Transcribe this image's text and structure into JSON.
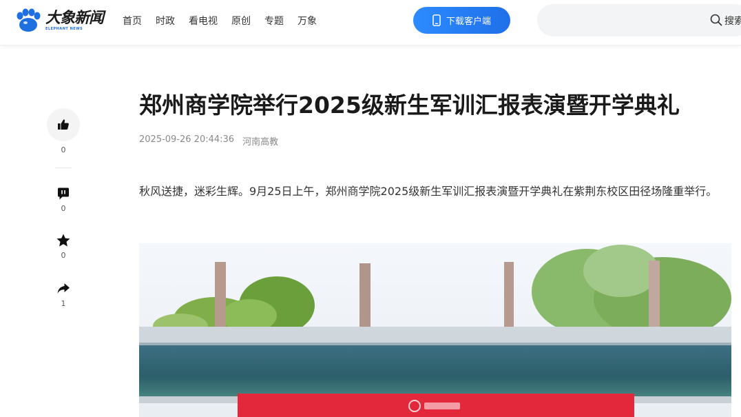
{
  "header": {
    "logo": {
      "cn": "大象新闻",
      "en": "ELEPHANT NEWS"
    },
    "nav": [
      "首页",
      "时政",
      "看电视",
      "原创",
      "专题",
      "万象"
    ],
    "download_label": "下载客户端",
    "search_label": "搜索"
  },
  "rail": {
    "like_count": "0",
    "comment_count": "0",
    "favorite_count": "0",
    "share_count": "1"
  },
  "article": {
    "title": "郑州商学院举行2025级新生军训汇报表演暨开学典礼",
    "date": "2025-09-26 20:44:36",
    "source": "河南高教",
    "paragraph": "秋风送捷，迷彩生辉。9月25日上午，郑州商学院2025级新生军训汇报表演暨开学典礼在紫荆东校区田径场隆重举行。"
  },
  "colors": {
    "accent": "#1f6fe8",
    "banner_red": "#e3283c"
  },
  "icons": {
    "like": "thumbs-up-icon",
    "comment": "comment-icon",
    "favorite": "star-icon",
    "share": "share-icon",
    "search": "search-icon",
    "phone": "phone-icon"
  }
}
